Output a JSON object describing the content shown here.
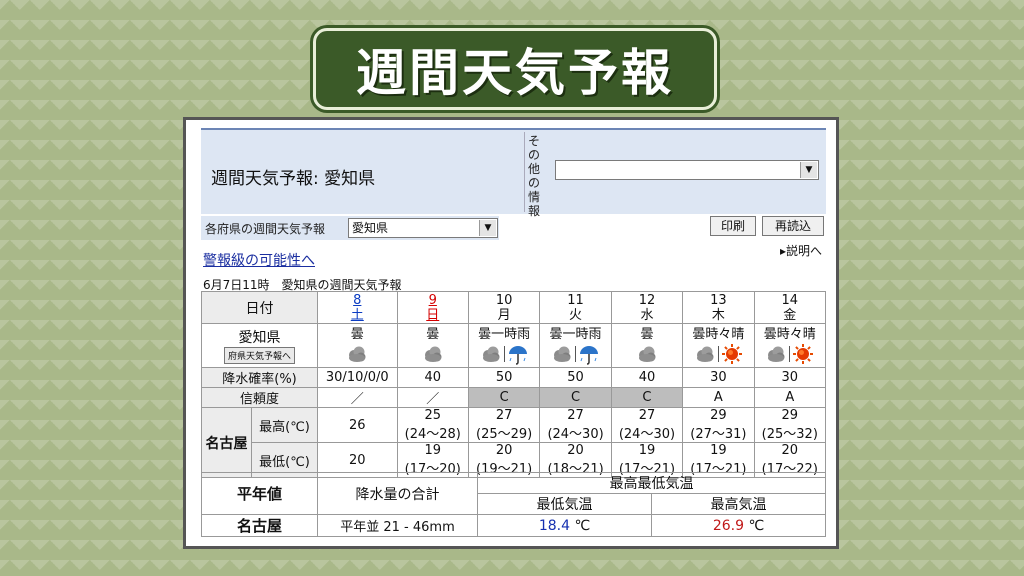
{
  "banner": {
    "title": "週間天気予報"
  },
  "header": {
    "title": "週間天気予報: 愛知県",
    "other_label": "その他の情報",
    "other_select_value": ""
  },
  "controls": {
    "pref_label": "各府県の週間天気予報",
    "pref_value": "愛知県",
    "print_label": "印刷",
    "reload_label": "再読込",
    "help_label": "説明へ",
    "warn_link": "警報級の可能性へ",
    "issued": "6月7日11時　愛知県の週間天気予報"
  },
  "table": {
    "date_header": "日付",
    "days": [
      {
        "date": "8",
        "weekday": "土",
        "weather": "曇",
        "icons": [
          "cloud"
        ],
        "pop": "30/10/0/0",
        "reliability": "／",
        "max": "26",
        "max_range": "",
        "min": "20",
        "min_range": ""
      },
      {
        "date": "9",
        "weekday": "日",
        "weather": "曇",
        "icons": [
          "cloud"
        ],
        "pop": "40",
        "reliability": "／",
        "max": "25",
        "max_range": "(24〜28)",
        "min": "19",
        "min_range": "(17〜20)"
      },
      {
        "date": "10",
        "weekday": "月",
        "weather": "曇一時雨",
        "icons": [
          "cloud",
          "umbrella"
        ],
        "pop": "50",
        "reliability": "C",
        "max": "27",
        "max_range": "(25〜29)",
        "min": "20",
        "min_range": "(19〜21)"
      },
      {
        "date": "11",
        "weekday": "火",
        "weather": "曇一時雨",
        "icons": [
          "cloud",
          "umbrella"
        ],
        "pop": "50",
        "reliability": "C",
        "max": "27",
        "max_range": "(24〜30)",
        "min": "20",
        "min_range": "(18〜21)"
      },
      {
        "date": "12",
        "weekday": "水",
        "weather": "曇",
        "icons": [
          "cloud"
        ],
        "pop": "40",
        "reliability": "C",
        "max": "27",
        "max_range": "(24〜30)",
        "min": "19",
        "min_range": "(17〜21)"
      },
      {
        "date": "13",
        "weekday": "木",
        "weather": "曇時々晴",
        "icons": [
          "cloud",
          "sun"
        ],
        "pop": "30",
        "reliability": "A",
        "max": "29",
        "max_range": "(27〜31)",
        "min": "19",
        "min_range": "(17〜21)"
      },
      {
        "date": "14",
        "weekday": "金",
        "weather": "曇時々晴",
        "icons": [
          "cloud",
          "sun"
        ],
        "pop": "30",
        "reliability": "A",
        "max": "29",
        "max_range": "(25〜32)",
        "min": "20",
        "min_range": "(17〜22)"
      }
    ],
    "region_label": "愛知県",
    "region_button": "府県天気予報へ",
    "pop_label": "降水確率(%)",
    "reliability_label": "信頼度",
    "city_label": "名古屋",
    "max_label": "最高(℃)",
    "min_label": "最低(℃)"
  },
  "averages": {
    "title": "平年値",
    "precip_header": "降水量の合計",
    "temp_header": "最高最低気温",
    "min_header": "最低気温",
    "max_header": "最高気温",
    "city": "名古屋",
    "precip_value": "平年並 21 - 46mm",
    "min_value": "18.4",
    "max_value": "26.9",
    "unit": "℃"
  }
}
